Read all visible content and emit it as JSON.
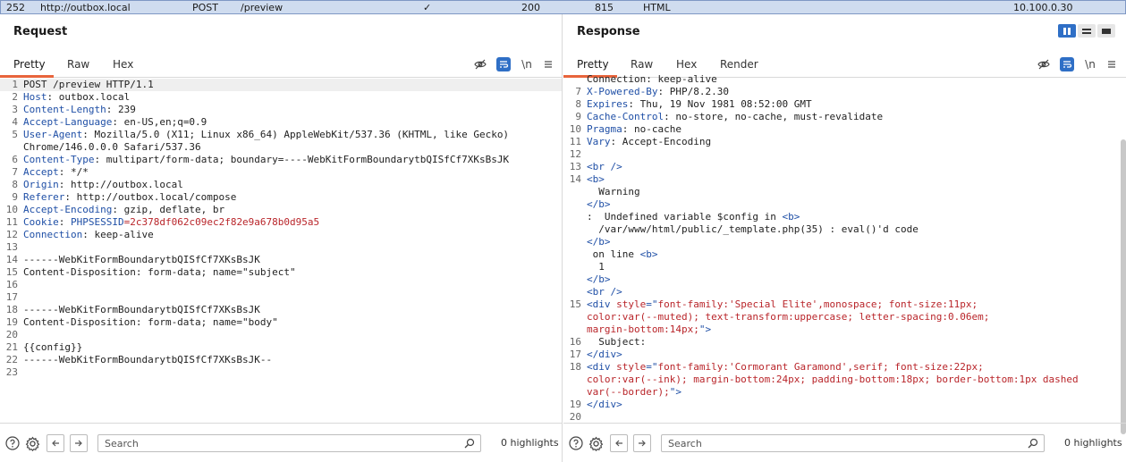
{
  "history": {
    "id": "252",
    "host": "http://outbox.local",
    "method": "POST",
    "url": "/preview",
    "edited": "✓",
    "status": "200",
    "length": "815",
    "mime": "HTML",
    "ip": "10.100.0.30"
  },
  "request": {
    "title": "Request",
    "tabs": [
      "Pretty",
      "Raw",
      "Hex"
    ],
    "newline_label": "\\n",
    "search_placeholder": "Search",
    "highlights": "0 highlights",
    "lines": [
      {
        "n": "1",
        "parts": [
          {
            "t": "POST /preview HTTP/1.1",
            "c": "hval"
          }
        ]
      },
      {
        "n": "2",
        "parts": [
          {
            "t": "Host",
            "c": "hkey"
          },
          {
            "t": ": outbox.local",
            "c": "hval"
          }
        ]
      },
      {
        "n": "3",
        "parts": [
          {
            "t": "Content-Length",
            "c": "hkey"
          },
          {
            "t": ": 239",
            "c": "hval"
          }
        ]
      },
      {
        "n": "4",
        "parts": [
          {
            "t": "Accept-Language",
            "c": "hkey"
          },
          {
            "t": ": en-US,en;q=0.9",
            "c": "hval"
          }
        ]
      },
      {
        "n": "5",
        "parts": [
          {
            "t": "User-Agent",
            "c": "hkey"
          },
          {
            "t": ": Mozilla/5.0 (X11; Linux x86_64) AppleWebKit/537.36 (KHTML, like Gecko)",
            "c": "hval"
          }
        ]
      },
      {
        "n": "",
        "parts": [
          {
            "t": "Chrome/146.0.0.0 Safari/537.36",
            "c": "hval"
          }
        ]
      },
      {
        "n": "6",
        "parts": [
          {
            "t": "Content-Type",
            "c": "hkey"
          },
          {
            "t": ": multipart/form-data; boundary=----WebKitFormBoundarytbQISfCf7XKsBsJK",
            "c": "hval"
          }
        ]
      },
      {
        "n": "7",
        "parts": [
          {
            "t": "Accept",
            "c": "hkey"
          },
          {
            "t": ": */*",
            "c": "hval"
          }
        ]
      },
      {
        "n": "8",
        "parts": [
          {
            "t": "Origin",
            "c": "hkey"
          },
          {
            "t": ": http://outbox.local",
            "c": "hval"
          }
        ]
      },
      {
        "n": "9",
        "parts": [
          {
            "t": "Referer",
            "c": "hkey"
          },
          {
            "t": ": http://outbox.local/compose",
            "c": "hval"
          }
        ]
      },
      {
        "n": "10",
        "parts": [
          {
            "t": "Accept-Encoding",
            "c": "hkey"
          },
          {
            "t": ": gzip, deflate, br",
            "c": "hval"
          }
        ]
      },
      {
        "n": "11",
        "parts": [
          {
            "t": "Cookie",
            "c": "hkey"
          },
          {
            "t": ": ",
            "c": "hval"
          },
          {
            "t": "PHPSESSID",
            "c": "hkey"
          },
          {
            "t": "=2c378df062c09ec2f82e9a678b0d95a5",
            "c": "cookie-val"
          }
        ]
      },
      {
        "n": "12",
        "parts": [
          {
            "t": "Connection",
            "c": "hkey"
          },
          {
            "t": ": keep-alive",
            "c": "hval"
          }
        ]
      },
      {
        "n": "13",
        "parts": []
      },
      {
        "n": "14",
        "parts": [
          {
            "t": "------WebKitFormBoundarytbQISfCf7XKsBsJK",
            "c": "hval"
          }
        ]
      },
      {
        "n": "15",
        "parts": [
          {
            "t": "Content-Disposition: form-data; name=\"subject\"",
            "c": "hval"
          }
        ]
      },
      {
        "n": "16",
        "parts": []
      },
      {
        "n": "17",
        "parts": []
      },
      {
        "n": "18",
        "parts": [
          {
            "t": "------WebKitFormBoundarytbQISfCf7XKsBsJK",
            "c": "hval"
          }
        ]
      },
      {
        "n": "19",
        "parts": [
          {
            "t": "Content-Disposition: form-data; name=\"body\"",
            "c": "hval"
          }
        ]
      },
      {
        "n": "20",
        "parts": []
      },
      {
        "n": "21",
        "parts": [
          {
            "t": "{{config}}",
            "c": "hval"
          }
        ]
      },
      {
        "n": "22",
        "parts": [
          {
            "t": "------WebKitFormBoundarytbQISfCf7XKsBsJK--",
            "c": "hval"
          }
        ]
      },
      {
        "n": "23",
        "parts": []
      }
    ]
  },
  "response": {
    "title": "Response",
    "tabs": [
      "Pretty",
      "Raw",
      "Hex",
      "Render"
    ],
    "newline_label": "\\n",
    "search_placeholder": "Search",
    "highlights": "0 highlights",
    "lines": [
      {
        "n": "",
        "parts": [
          {
            "t": "Connection: keep-alive",
            "c": "hval"
          }
        ]
      },
      {
        "n": "7",
        "parts": [
          {
            "t": "X-Powered-By",
            "c": "hkey"
          },
          {
            "t": ": PHP/8.2.30",
            "c": "hval"
          }
        ]
      },
      {
        "n": "8",
        "parts": [
          {
            "t": "Expires",
            "c": "hkey"
          },
          {
            "t": ": Thu, 19 Nov 1981 08:52:00 GMT",
            "c": "hval"
          }
        ]
      },
      {
        "n": "9",
        "parts": [
          {
            "t": "Cache-Control",
            "c": "hkey"
          },
          {
            "t": ": no-store, no-cache, must-revalidate",
            "c": "hval"
          }
        ]
      },
      {
        "n": "10",
        "parts": [
          {
            "t": "Pragma",
            "c": "hkey"
          },
          {
            "t": ": no-cache",
            "c": "hval"
          }
        ]
      },
      {
        "n": "11",
        "parts": [
          {
            "t": "Vary",
            "c": "hkey"
          },
          {
            "t": ": Accept-Encoding",
            "c": "hval"
          }
        ]
      },
      {
        "n": "12",
        "parts": []
      },
      {
        "n": "13",
        "parts": [
          {
            "t": "<br />",
            "c": "tag"
          }
        ]
      },
      {
        "n": "14",
        "parts": [
          {
            "t": "<b>",
            "c": "tag"
          }
        ]
      },
      {
        "n": "",
        "parts": [
          {
            "t": "  Warning",
            "c": "hval"
          }
        ]
      },
      {
        "n": "",
        "parts": [
          {
            "t": "</b>",
            "c": "tag"
          }
        ]
      },
      {
        "n": "",
        "parts": [
          {
            "t": ":  Undefined variable $config in ",
            "c": "hval"
          },
          {
            "t": "<b>",
            "c": "tag"
          }
        ]
      },
      {
        "n": "",
        "parts": [
          {
            "t": "  /var/www/html/public/_template.php(35) : eval()'d code",
            "c": "hval"
          }
        ]
      },
      {
        "n": "",
        "parts": [
          {
            "t": "</b>",
            "c": "tag"
          }
        ]
      },
      {
        "n": "",
        "parts": [
          {
            "t": " on line ",
            "c": "hval"
          },
          {
            "t": "<b>",
            "c": "tag"
          }
        ]
      },
      {
        "n": "",
        "parts": [
          {
            "t": "  1",
            "c": "hval"
          }
        ]
      },
      {
        "n": "",
        "parts": [
          {
            "t": "</b>",
            "c": "tag"
          }
        ]
      },
      {
        "n": "",
        "parts": [
          {
            "t": "<br />",
            "c": "tag"
          }
        ]
      },
      {
        "n": "15",
        "parts": [
          {
            "t": "<div ",
            "c": "tag"
          },
          {
            "t": "style",
            "c": "attr"
          },
          {
            "t": "=\"",
            "c": "tag"
          },
          {
            "t": "font-family:'Special Elite',monospace; font-size:11px;",
            "c": "attr"
          }
        ]
      },
      {
        "n": "",
        "parts": [
          {
            "t": "color:var(--muted); text-transform:uppercase; letter-spacing:0.06em;",
            "c": "attr"
          }
        ]
      },
      {
        "n": "",
        "parts": [
          {
            "t": "margin-bottom:14px;",
            "c": "attr"
          },
          {
            "t": "\">",
            "c": "tag"
          }
        ]
      },
      {
        "n": "16",
        "parts": [
          {
            "t": "  Subject:",
            "c": "hval"
          }
        ]
      },
      {
        "n": "17",
        "parts": [
          {
            "t": "</div>",
            "c": "tag"
          }
        ]
      },
      {
        "n": "18",
        "parts": [
          {
            "t": "<div ",
            "c": "tag"
          },
          {
            "t": "style",
            "c": "attr"
          },
          {
            "t": "=\"",
            "c": "tag"
          },
          {
            "t": "font-family:'Cormorant Garamond',serif; font-size:22px;",
            "c": "attr"
          }
        ]
      },
      {
        "n": "",
        "parts": [
          {
            "t": "color:var(--ink); margin-bottom:24px; padding-bottom:18px; border-bottom:1px dashed",
            "c": "attr"
          }
        ]
      },
      {
        "n": "",
        "parts": [
          {
            "t": "var(--border);",
            "c": "attr"
          },
          {
            "t": "\">",
            "c": "tag"
          }
        ]
      },
      {
        "n": "19",
        "parts": [
          {
            "t": "</div>",
            "c": "tag"
          }
        ]
      },
      {
        "n": "20",
        "parts": []
      }
    ]
  }
}
